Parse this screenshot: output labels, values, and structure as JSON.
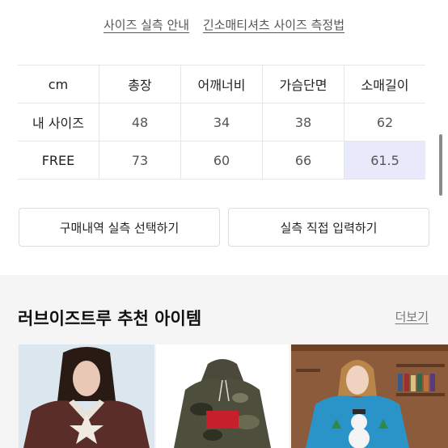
{
  "top_links": [
    "사이즈 실측 안내",
    "긴소매티셔츠 사이즈 측정법"
  ],
  "size_table": {
    "headers": [
      "cm",
      "총장",
      "어깨너비",
      "가슴단면",
      "소매길이"
    ],
    "rows": [
      {
        "label": "내 사이즈",
        "values": [
          "48",
          "34",
          "38",
          "62"
        ]
      },
      {
        "label": "FREE",
        "values": [
          "73",
          "60",
          "66",
          "61.5"
        ]
      }
    ]
  },
  "buttons": {
    "select_history": "구매내역 실측 선택하기",
    "direct_input": "실측 직접 입력하기"
  },
  "recommend": {
    "title": "러브이즈트루 추천 아이템",
    "more_label": "더보기"
  },
  "colors": {
    "highlight": "#e8eafb",
    "section_bg": "#f5f5f5"
  }
}
